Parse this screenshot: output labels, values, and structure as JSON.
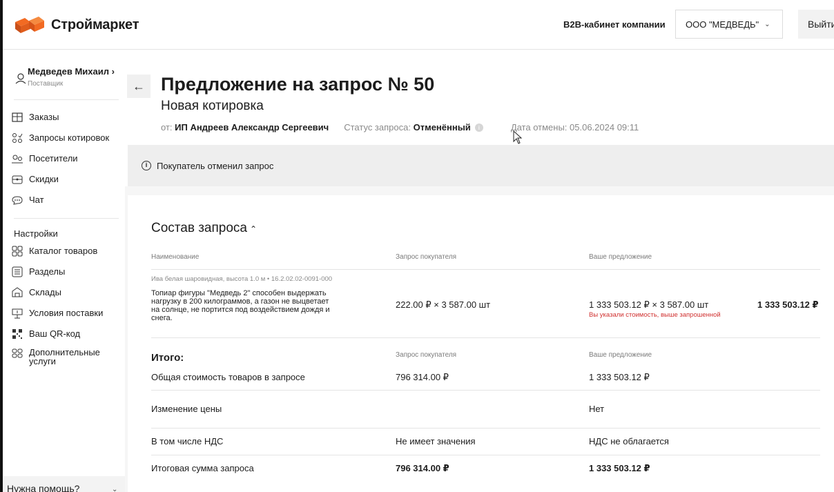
{
  "header": {
    "brand": "Строймаркет",
    "b2b_label": "B2B-кабинет компании",
    "company": "ООО \"МЕДВЕДЬ\"",
    "logout": "Выйти"
  },
  "user": {
    "name": "Медведев Михаил ›",
    "role": "Поставщик"
  },
  "sidebar": {
    "items": [
      {
        "label": "Заказы",
        "icon": "orders-icon"
      },
      {
        "label": "Запросы котировок",
        "icon": "quotes-icon"
      },
      {
        "label": "Посетители",
        "icon": "visitors-icon"
      },
      {
        "label": "Скидки",
        "icon": "discount-icon"
      },
      {
        "label": "Чат",
        "icon": "chat-icon"
      }
    ],
    "settings_label": "Настройки",
    "settings_items": [
      {
        "label": "Каталог товаров",
        "icon": "catalog-icon"
      },
      {
        "label": "Разделы",
        "icon": "sections-icon"
      },
      {
        "label": "Склады",
        "icon": "warehouse-icon"
      },
      {
        "label": "Условия поставки",
        "icon": "delivery-icon"
      },
      {
        "label": "Ваш QR-код",
        "icon": "qr-icon"
      },
      {
        "label": "Дополнительные услуги",
        "icon": "services-icon"
      }
    ],
    "help": "Нужна помощь?"
  },
  "page": {
    "title": "Предложение на запрос № 50",
    "subtitle": "Новая котировка",
    "from_label": "от:",
    "from_value": "ИП Андреев Александр Сергеевич",
    "status_label": "Статус запроса:",
    "status_value": "Отменённый",
    "cancel_date": "Дата отмены: 05.06.2024 09:11",
    "alert": "Покупатель отменил запрос"
  },
  "composition": {
    "title": "Состав запроса",
    "columns": [
      "Наименование",
      "Запрос покупателя",
      "Ваше предложение"
    ],
    "item": {
      "sku": "Ива белая шаровидная, высота 1.0 м  •  16.2.02.02-0091-000",
      "description": "Топиар фигуры \"Медведь 2\" способен выдержать нагрузку в 200 килограммов, а газон не выцветает на солнце, не портится под воздействием дождя и снега.",
      "buyer_request": "222.00 ₽ × 3 587.00 шт",
      "offer": "1 333 503.12 ₽ × 3 587.00 шт",
      "offer_total": "1 333 503.12 ₽",
      "warning": "Вы указали стоимость, выше запрошенной"
    }
  },
  "totals": {
    "title": "Итого:",
    "col_buyer": "Запрос покупателя",
    "col_offer": "Ваше предложение",
    "rows": [
      {
        "label": "Общая стоимость товаров в запросе",
        "buyer": "796 314.00 ₽",
        "offer": "1 333 503.12 ₽"
      },
      {
        "label": "Изменение цены",
        "buyer": "",
        "offer": "Нет"
      },
      {
        "label": "В том числе НДС",
        "buyer": "Не имеет значения",
        "offer": "НДС не облагается"
      },
      {
        "label": "Итоговая сумма запроса",
        "buyer": "796 314.00 ₽",
        "offer": "1 333 503.12 ₽"
      }
    ]
  },
  "colors": {
    "brand_orange": "#f26a22",
    "warning_red": "#d0302f",
    "muted": "#8a8a8a"
  }
}
